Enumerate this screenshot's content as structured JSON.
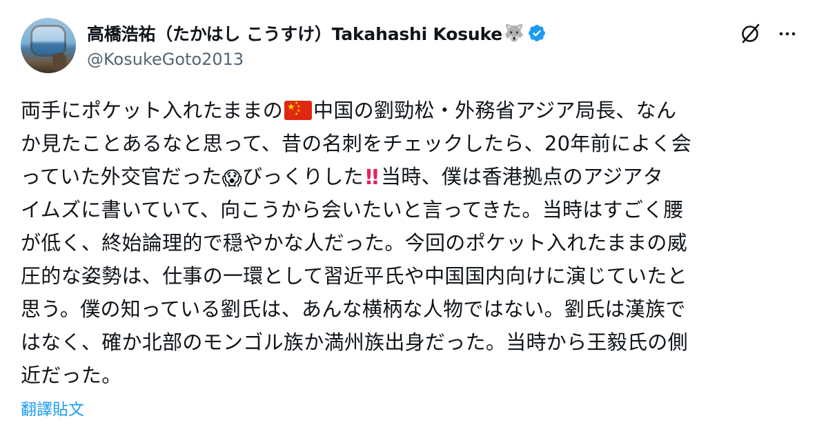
{
  "author": {
    "display_name": "高橋浩祐（たかはし こうすけ）Takahashi Kosuke",
    "name_emoji": "🐺",
    "handle": "@KosukeGoto2013",
    "verified": true
  },
  "icons": {
    "avatar": "profile-photo",
    "verified": "verified-badge-icon",
    "grok": "grok-icon",
    "more": "more-options-icon"
  },
  "colors": {
    "text": "#0f1419",
    "secondary_text": "#536471",
    "link": "#1d9bf0",
    "verified_blue": "#1d9bf0"
  },
  "post": {
    "line1_a": "両手にポケット入れたままの",
    "line1_b": "中国の劉勁松・外務省アジア局長、なん",
    "line2": "か見たことあるなと思って、昔の名刺をチェックしたら、20年前によく会",
    "line3_a": "っていた外交官だった",
    "line3_b": "びっくりした",
    "line3_c": "当時、僕は香港拠点のアジアタ",
    "line4": "イムズに書いていて、向こうから会いたいと言ってきた。当時はすごく腰",
    "line5": "が低く、終始論理的で穏やかな人だった。今回のポケット入れたままの威",
    "line6": "圧的な姿勢は、仕事の一環として習近平氏や中国国内向けに演じていたと",
    "line7": "思う。僕の知っている劉氏は、あんな横柄な人物ではない。劉氏は漢族で",
    "line8": "はなく、確か北部のモンゴル族か満州族出身だった。当時から王毅氏の側",
    "line9": "近だった。",
    "emoji_scream": "😱",
    "emoji_bang": "‼"
  },
  "translate_label": "翻譯貼文"
}
